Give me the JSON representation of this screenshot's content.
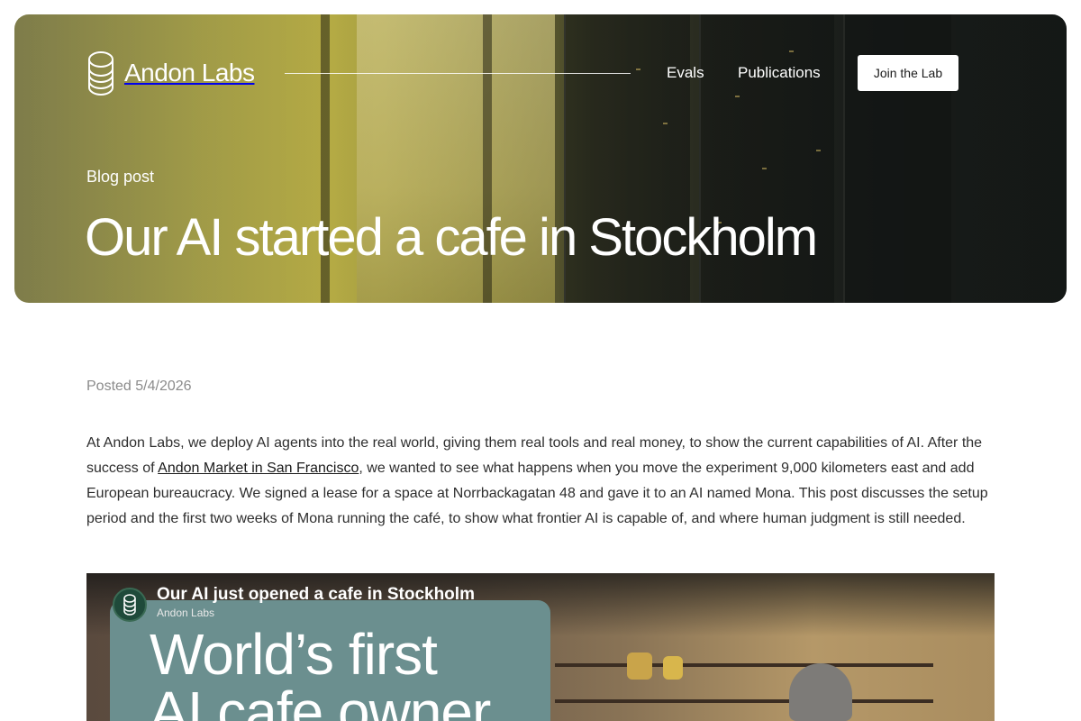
{
  "brand": {
    "name": "Andon Labs"
  },
  "nav": {
    "links": [
      "Evals",
      "Publications"
    ],
    "cta": "Join the Lab"
  },
  "hero": {
    "kicker": "Blog post",
    "title": "Our AI started a cafe in Stockholm"
  },
  "post": {
    "posted": "Posted 5/4/2026",
    "intro_before_link": "At Andon Labs, we deploy AI agents into the real world, giving them real tools and real money, to show the current capabilities of AI. After the success of ",
    "link_text": "Andon Market in San Francisco",
    "intro_after_link": ", we wanted to see what happens when you move the experiment 9,000 kilometers east and add European bureaucracy. We signed a lease for a space at Norrbackagatan 48 and gave it to an AI named Mona. This post discusses the setup period and the first two weeks of Mona running the café, to show what frontier AI is capable of, and where human judgment is still needed."
  },
  "video": {
    "title": "Our AI just opened a cafe in Stockholm",
    "channel": "Andon Labs",
    "thumbnail_text_line1": "World’s first",
    "thumbnail_text_line2": "AI cafe owner"
  },
  "colors": {
    "card_teal": "#6b8f8f",
    "hero_yellow": "#b7ad45",
    "hero_dark": "#1b201d"
  },
  "icons": {
    "logo": "stacked-coins-logo",
    "channel_avatar": "andon-labs-avatar"
  }
}
